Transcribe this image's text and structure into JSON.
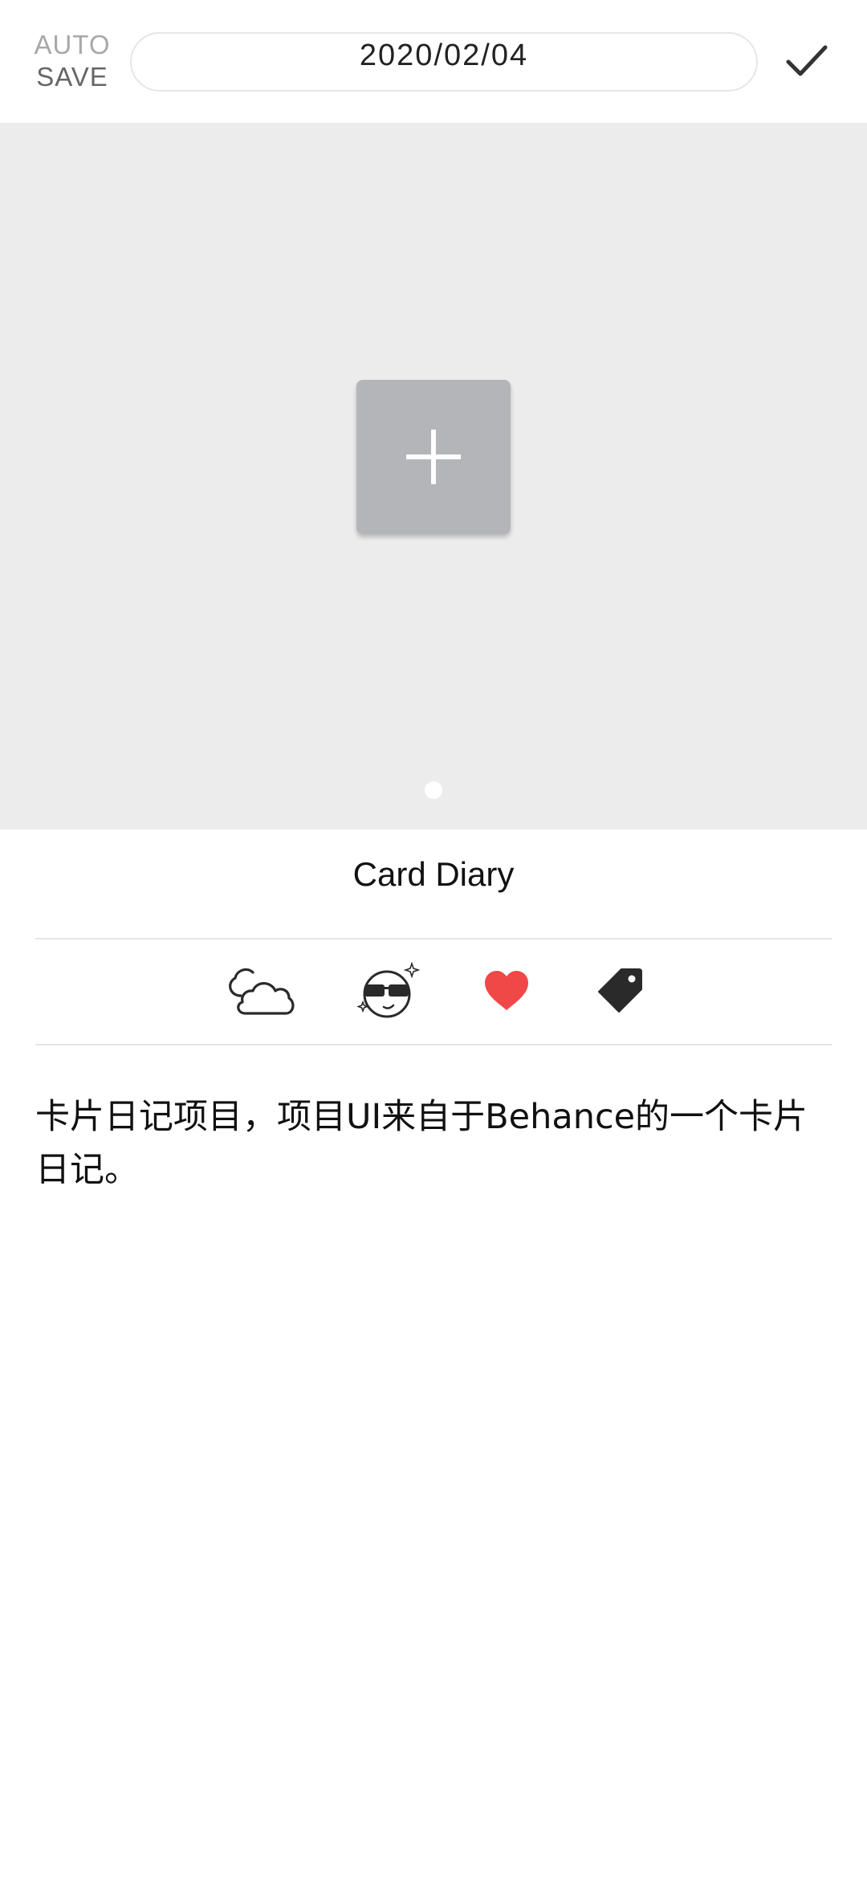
{
  "header": {
    "autosave_top": "AUTO",
    "autosave_bottom": "SAVE",
    "date": "2020/02/04",
    "confirm_icon": "check-icon"
  },
  "image_area": {
    "add_icon": "plus-icon",
    "page_indicator_count": 1,
    "active_page": 1
  },
  "card": {
    "title": "Card Diary",
    "attributes": {
      "weather_icon": "cloud-icon",
      "mood_icon": "cool-face-icon",
      "favorite_icon": "heart-icon",
      "tag_icon": "tag-icon"
    },
    "content": "卡片日记项目，项目UI来自于Behance的一个卡片日记。"
  },
  "colors": {
    "background": "#ffffff",
    "image_area_bg": "#ececec",
    "add_button_bg": "#b4b5b9",
    "heart": "#f04747",
    "icon_dark": "#2a2a2a",
    "divider": "#e5e5e5",
    "autosave_top": "#a8a8a8",
    "autosave_bottom": "#666666"
  }
}
